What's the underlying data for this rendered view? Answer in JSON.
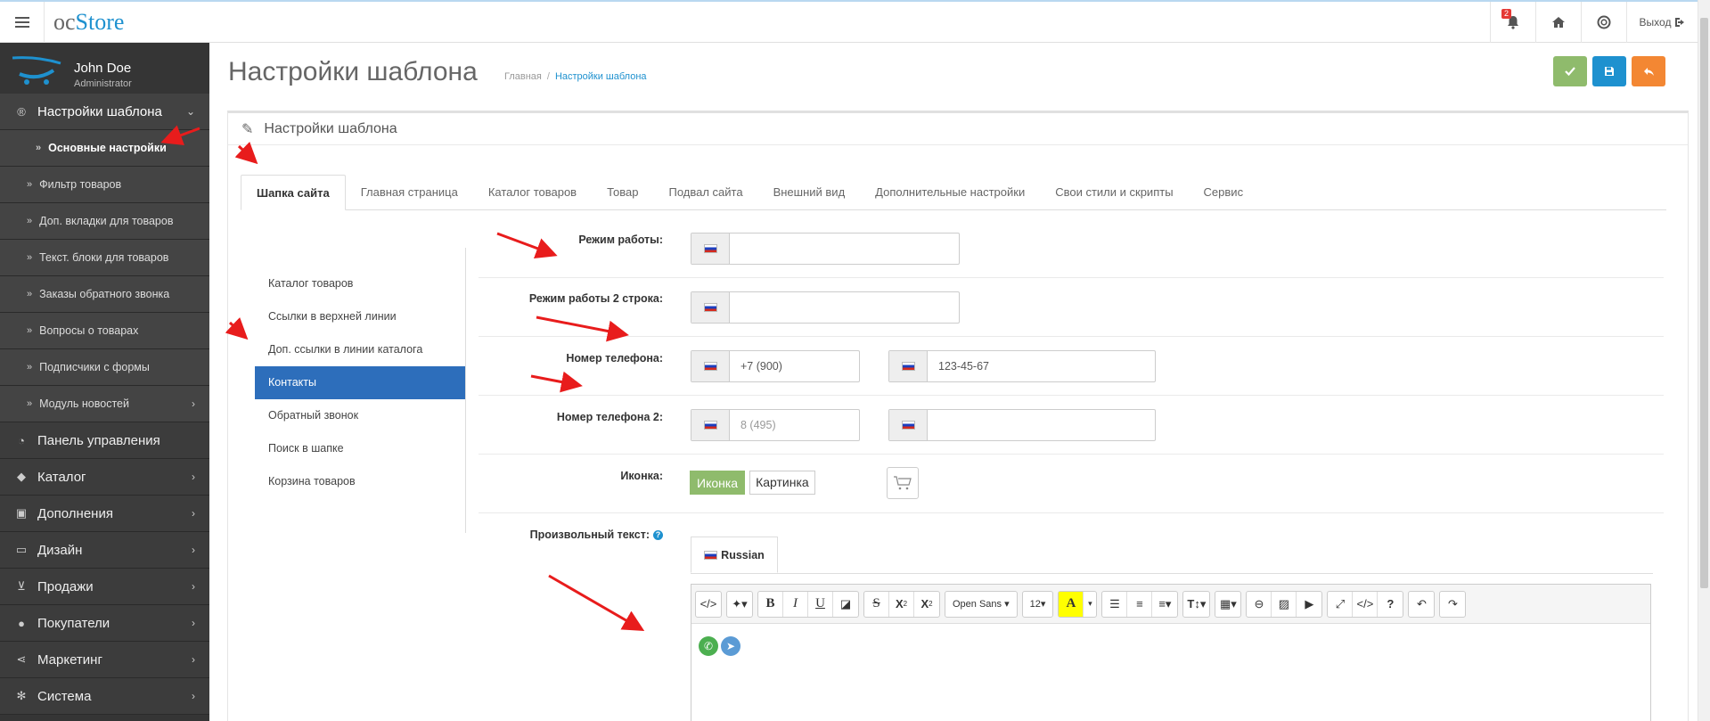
{
  "brand": {
    "prefix": "oc",
    "name": "Store"
  },
  "header": {
    "notifications_count": "2",
    "logout_label": "Выход"
  },
  "user": {
    "name": "John Doe",
    "role": "Administrator"
  },
  "sidebar": {
    "section_title": "Настройки шаблона",
    "subitems": [
      {
        "label": "Основные настройки"
      },
      {
        "label": "Фильтр товаров"
      },
      {
        "label": "Доп. вкладки для товаров"
      },
      {
        "label": "Текст. блоки для товаров"
      },
      {
        "label": "Заказы обратного звонка"
      },
      {
        "label": "Вопросы о товарах"
      },
      {
        "label": "Подписчики с формы"
      },
      {
        "label": "Модуль новостей"
      }
    ],
    "items": [
      {
        "label": "Панель управления",
        "icon": "dashboard-icon"
      },
      {
        "label": "Каталог",
        "icon": "tag-icon"
      },
      {
        "label": "Дополнения",
        "icon": "puzzle-icon"
      },
      {
        "label": "Дизайн",
        "icon": "monitor-icon"
      },
      {
        "label": "Продажи",
        "icon": "cart-icon"
      },
      {
        "label": "Покупатели",
        "icon": "user-icon"
      },
      {
        "label": "Маркетинг",
        "icon": "share-icon"
      },
      {
        "label": "Система",
        "icon": "gear-icon"
      }
    ]
  },
  "page": {
    "title": "Настройки шаблона",
    "breadcrumb": [
      {
        "label": "Главная"
      },
      {
        "label": "Настройки шаблона"
      }
    ],
    "panel_title": "Настройки шаблона"
  },
  "tabs": [
    {
      "label": "Шапка сайта"
    },
    {
      "label": "Главная страница"
    },
    {
      "label": "Каталог товаров"
    },
    {
      "label": "Товар"
    },
    {
      "label": "Подвал сайта"
    },
    {
      "label": "Внешний вид"
    },
    {
      "label": "Дополнительные настройки"
    },
    {
      "label": "Свои стили и скрипты"
    },
    {
      "label": "Сервис"
    }
  ],
  "left_menu": [
    {
      "label": "Каталог товаров"
    },
    {
      "label": "Ссылки в верхней линии"
    },
    {
      "label": "Доп. ссылки в линии каталога"
    },
    {
      "label": "Контакты"
    },
    {
      "label": "Обратный звонок"
    },
    {
      "label": "Поиск в шапке"
    },
    {
      "label": "Корзина товаров"
    }
  ],
  "form": {
    "work_hours": {
      "label": "Режим работы:",
      "value": ""
    },
    "work_hours2": {
      "label": "Режим работы 2 строка:",
      "value": ""
    },
    "phone": {
      "label": "Номер телефона:",
      "code": "+7 (900)",
      "number": "123-45-67"
    },
    "phone2": {
      "label": "Номер телефона 2:",
      "code_placeholder": "8 (495)",
      "number": ""
    },
    "icon": {
      "label": "Иконка:",
      "option_icon": "Иконка",
      "option_image": "Картинка"
    },
    "custom_text": {
      "label": "Произвольный текст:",
      "language_tab": "Russian"
    }
  },
  "editor": {
    "font_family": "Open Sans",
    "font_size": "12"
  },
  "colors": {
    "accent": "#1e91cf",
    "success": "#8fbb6c",
    "warning": "#f38733",
    "active_menu": "#2d6ebb",
    "sidebar": "#353535"
  }
}
